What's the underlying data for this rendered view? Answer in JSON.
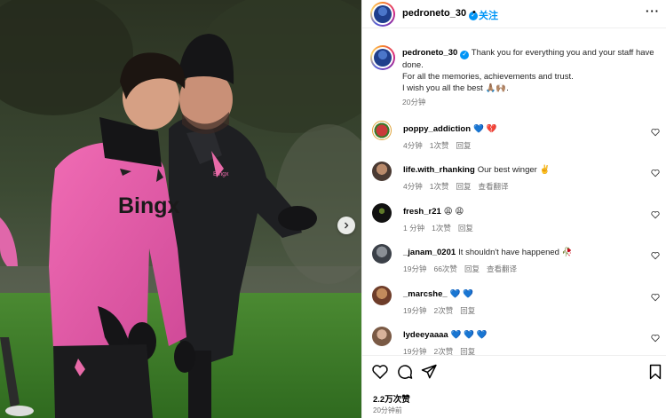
{
  "post": {
    "username": "pedroneto_30",
    "follow_label": "关注",
    "dot": "•",
    "more_label": "···"
  },
  "caption": {
    "username": "pedroneto_30",
    "line1": "Thank you for everything you and your staff have done.",
    "line2": "For all the memories, achievements and trust.",
    "line3": "I wish you all the best 🙏🏽🙌🏽.",
    "time": "20分钟"
  },
  "comments": [
    {
      "user": "poppy_addiction",
      "text": "💙 💔",
      "time": "4分钟",
      "likes": "1次赞",
      "reply": "回复",
      "translate": ""
    },
    {
      "user": "life.with_rhanking",
      "text": "Our best winger ✌️",
      "time": "4分钟",
      "likes": "1次赞",
      "reply": "回复",
      "translate": "查看翻译"
    },
    {
      "user": "fresh_r21",
      "text": "😩 😩",
      "time": "1 分钟",
      "likes": "1次赞",
      "reply": "回复",
      "translate": ""
    },
    {
      "user": "_janam_0201",
      "text": "It shouldn't have happened 🥀",
      "time": "19分钟",
      "likes": "66次赞",
      "reply": "回复",
      "translate": "查看翻译"
    },
    {
      "user": "_marcshe_",
      "text": "💙 💙",
      "time": "19分钟",
      "likes": "2次赞",
      "reply": "回复",
      "translate": ""
    },
    {
      "user": "lydeeyaaaa",
      "text": "💙 💙 💙",
      "time": "19分钟",
      "likes": "2次赞",
      "reply": "回复",
      "translate": ""
    }
  ],
  "footer": {
    "likes": "2.2万次赞",
    "posted": "20分钟前"
  },
  "photo": {
    "shirt_text": "Bingx",
    "shirt_text_small": "Bingx"
  },
  "colors": {
    "accent": "#0095f6",
    "shirt_pink": "#e85aa8",
    "coat_dark": "#1c1c1e"
  }
}
